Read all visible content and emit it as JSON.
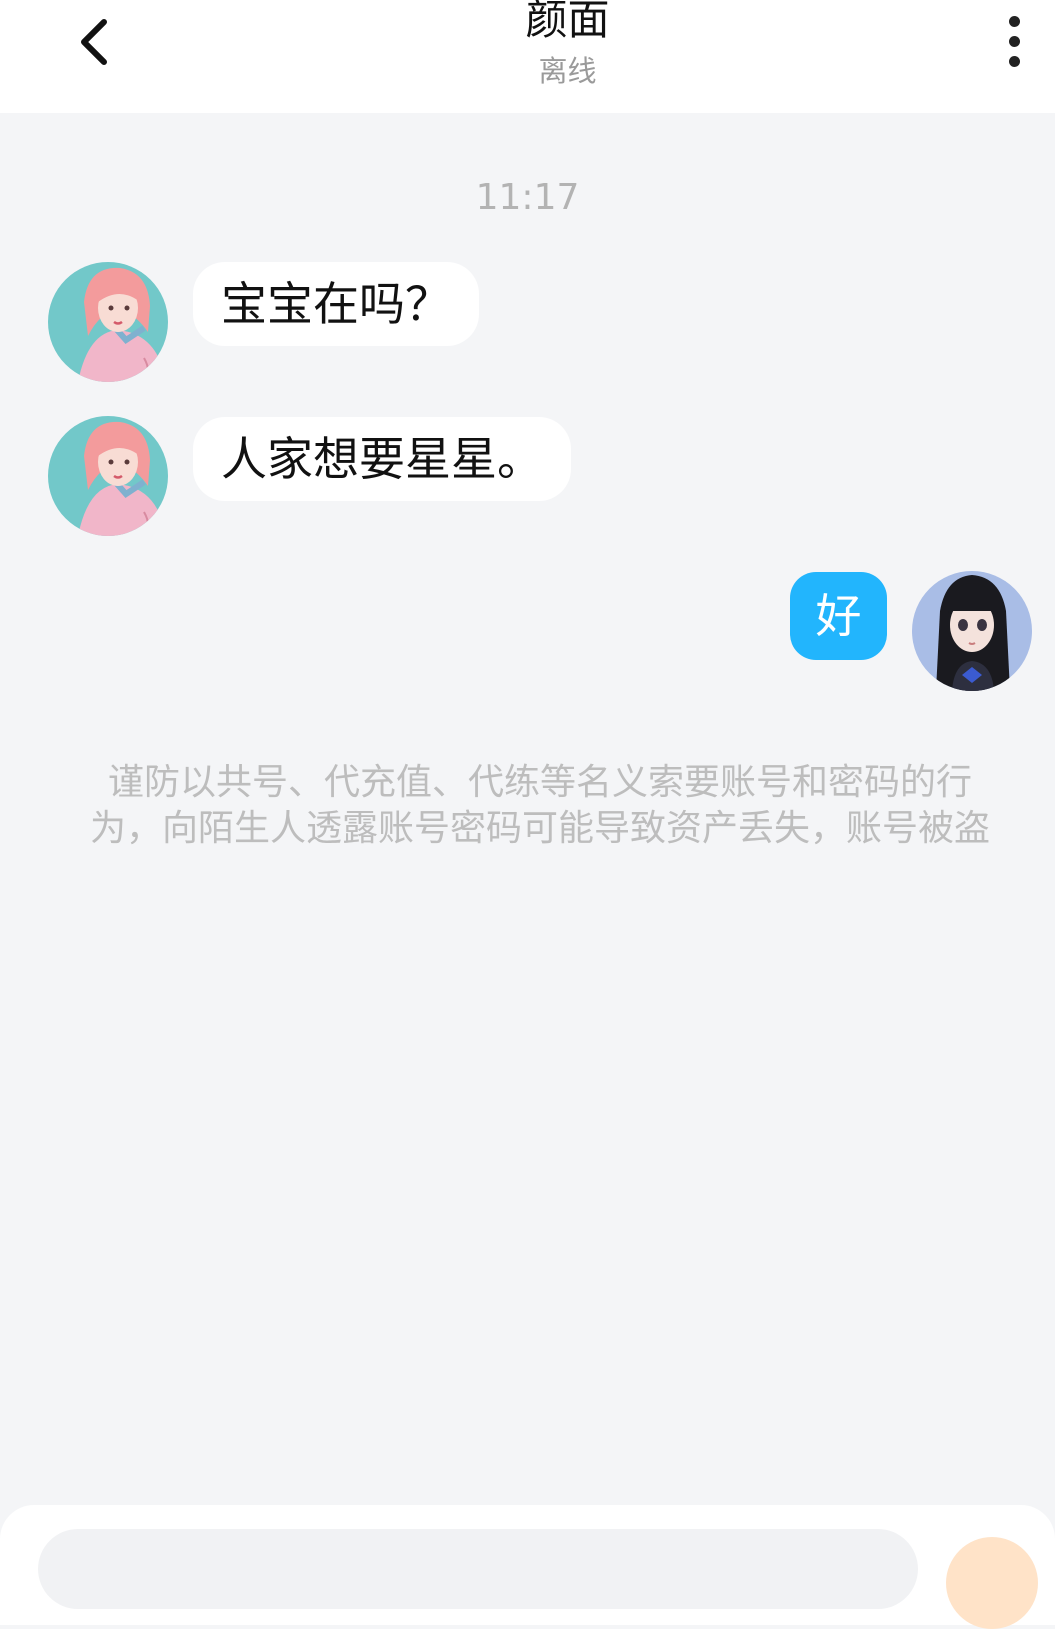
{
  "header": {
    "title": "颜面",
    "status": "离线"
  },
  "chat": {
    "time": "11:17",
    "messages": [
      {
        "from": "contact",
        "text": "宝宝在吗？"
      },
      {
        "from": "contact",
        "text": "人家想要星星。"
      },
      {
        "from": "me",
        "text": "好"
      }
    ]
  },
  "notice": "谨防以共号、代充值、代练等名义索要账号和密码的行为，向陌生人透露账号密码可能导致资产丢失，账号被盗",
  "icons": {
    "back": "chevron-left-icon",
    "more": "more-vertical-icon",
    "emoji": "emoji-icon"
  },
  "colors": {
    "my_bubble": "#22b5fd",
    "background": "#f4f5f7",
    "contact_avatar_bg": "#72c8c9"
  }
}
